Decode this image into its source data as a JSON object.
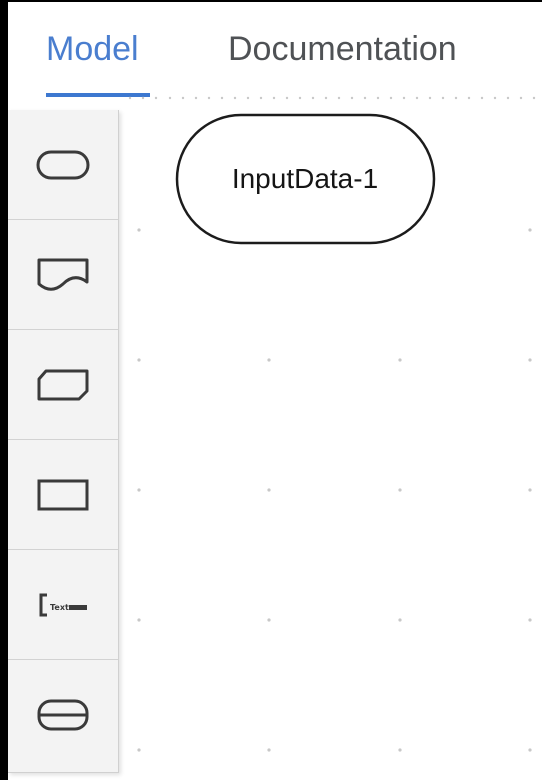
{
  "tabs": [
    {
      "label": "Model",
      "active": true
    },
    {
      "label": "Documentation",
      "active": false
    }
  ],
  "canvas": {
    "node": {
      "label": "InputData-1",
      "shape": "input-data-oval"
    }
  },
  "palette": {
    "items": [
      {
        "icon": "input-data-icon"
      },
      {
        "icon": "knowledge-source-icon"
      },
      {
        "icon": "business-knowledge-model-icon"
      },
      {
        "icon": "decision-icon"
      },
      {
        "icon": "text-annotation-icon"
      },
      {
        "icon": "decision-service-icon"
      }
    ]
  },
  "colors": {
    "accent": "#3d78d0",
    "active_tab_text": "#4a7ecf",
    "tab_text": "#4f5255",
    "palette_bg": "#f3f3f3",
    "icon_stroke": "#3a3a3a",
    "grid_dot": "#c8c8c8"
  }
}
